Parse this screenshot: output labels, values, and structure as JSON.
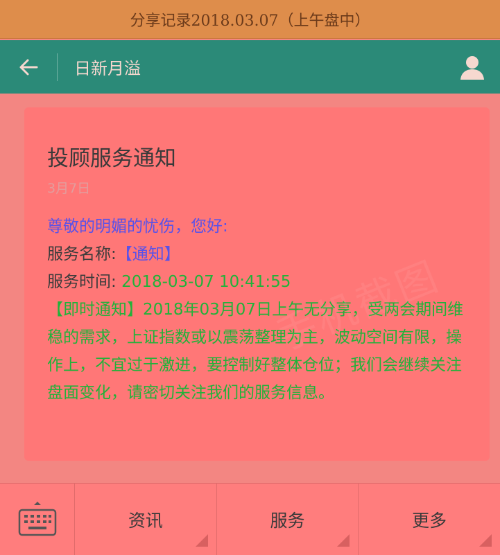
{
  "banner": {
    "text": "分享记录2018.03.07（上午盘中）"
  },
  "nav": {
    "title": "日新月溢"
  },
  "message": {
    "title": "投顾服务通知",
    "date": "3月7日",
    "greeting": "尊敬的明媚的忧伤，您好:",
    "service_name_label": "服务名称:",
    "service_name_value": "【通知】",
    "service_time_label": "服务时间:",
    "service_time_value": "2018-03-07 10:41:55",
    "notice_prefix": "【即时通知】",
    "notice_text": "2018年03月07日上午无分享，受两会期间维稳的需求，上证指数或以震荡整理为主，波动空间有限，操作上，不宜过于激进，要控制好整体仓位；我们会继续关注盘面变化，请密切关注我们的服务信息。"
  },
  "watermark": "手机截图",
  "menu": {
    "items": [
      {
        "label": "资讯"
      },
      {
        "label": "服务"
      },
      {
        "label": "更多"
      }
    ]
  },
  "colors": {
    "banner": "#de8d4b",
    "navbar": "#2b8a78",
    "background": "#f38682",
    "card": "#ff7777",
    "green_text": "#22b23a",
    "blue_text": "#5a52e8"
  }
}
